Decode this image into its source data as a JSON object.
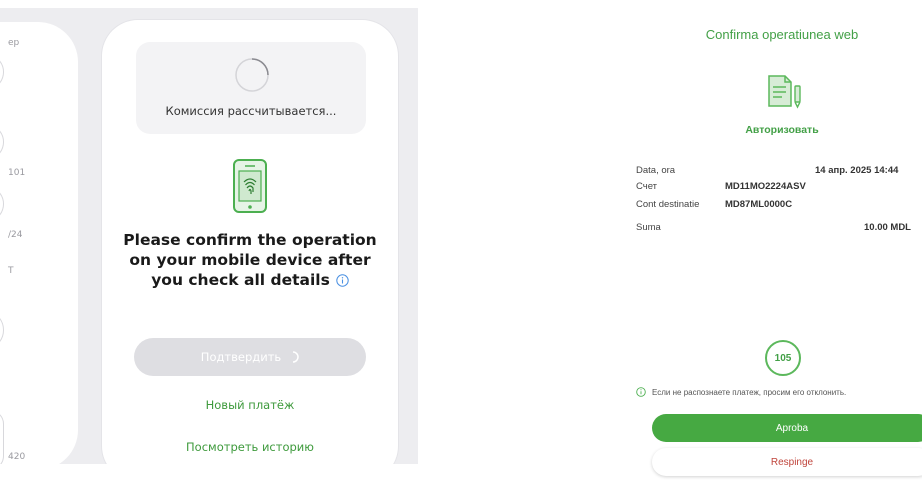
{
  "left": {
    "bg_labels": [
      "ep",
      "101",
      "/24",
      "T",
      "420"
    ],
    "fee_status": "Комиссия рассчитывается...",
    "confirm_message": "Please confirm the operation on your mobile device after you check all details",
    "confirm_button_label": "Подтвердить",
    "new_payment_label": "Новый платёж",
    "view_history_label": "Посмотреть историю",
    "stepper_symbol": "÷",
    "icons": [
      "spinner-icon",
      "phone-fingerprint-icon",
      "info-icon",
      "chevron-down-icon"
    ]
  },
  "right": {
    "title": "Confirma operatiunea web",
    "authorize_label": "Авторизовать",
    "rows": [
      {
        "label": "Data, ora",
        "value": "14 апр. 2025 14:44"
      },
      {
        "label": "Счет",
        "value": "MD11MO2224ASV"
      },
      {
        "label": "Cont destinatie",
        "value": "MD87ML0000C"
      },
      {
        "label": "Suma",
        "value": "10.00 MDL"
      }
    ],
    "timer_value": "105",
    "warning_text": "Если не распознаете платеж, просим его отклонить.",
    "approve_label": "Aproba",
    "reject_label": "Respinge",
    "icons": [
      "document-pen-icon",
      "info-icon"
    ]
  },
  "colors": {
    "accent_green": "#43a047",
    "reject_red": "#c0453c",
    "disabled_button": "#dedee2",
    "panel_background": "#ededf0"
  }
}
